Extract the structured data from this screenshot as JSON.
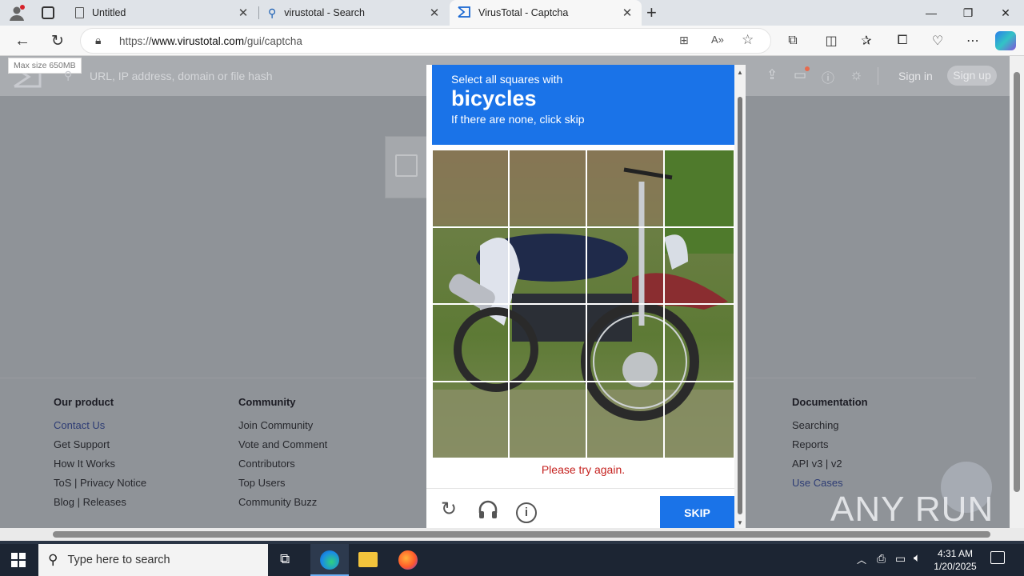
{
  "browser": {
    "tabs": [
      {
        "title": "Untitled",
        "icon": "page-icon"
      },
      {
        "title": "virustotal - Search",
        "icon": "search-icon"
      },
      {
        "title": "VirusTotal - Captcha",
        "icon": "virustotal-icon"
      }
    ],
    "url_prefix": "https://",
    "url_host": "www.virustotal.com",
    "url_path": "/gui/captcha"
  },
  "vt_header": {
    "tooltip": "Max size 650MB",
    "search_placeholder": "URL, IP address, domain or file hash",
    "sign_in": "Sign in",
    "sign_up": "Sign up"
  },
  "footer": {
    "columns": [
      {
        "heading": "Our product",
        "links": [
          "Contact Us",
          "Get Support",
          "How It Works",
          "ToS | Privacy Notice",
          "Blog | Releases"
        ]
      },
      {
        "heading": "Community",
        "links": [
          "Join Community",
          "Vote and Comment",
          "Contributors",
          "Top Users",
          "Community Buzz"
        ]
      },
      {
        "heading": "Documentation",
        "links": [
          "Searching",
          "Reports",
          "API v3 | v2",
          "Use Cases"
        ]
      }
    ]
  },
  "captcha": {
    "prompt_line1": "Select all squares with",
    "target": "bicycles",
    "prompt_line3": "If there are none, click skip",
    "error": "Please try again.",
    "skip": "SKIP"
  },
  "watermark": "ANY RUN",
  "taskbar": {
    "search_placeholder": "Type here to search",
    "time": "4:31 AM",
    "date": "1/20/2025"
  },
  "colors": {
    "accent": "#1a73e8",
    "error": "#c5221f"
  }
}
